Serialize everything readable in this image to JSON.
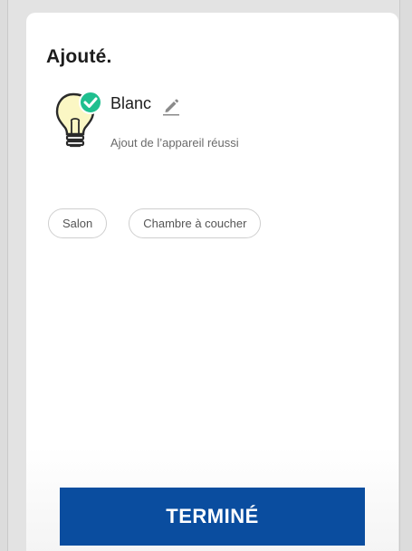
{
  "header": {
    "title": "Ajouté."
  },
  "device": {
    "name": "Blanc",
    "status": "Ajout de l’appareil réussi",
    "icon": "lightbulb-icon",
    "badge_icon": "check-circle-icon",
    "edit_icon": "pencil-icon"
  },
  "rooms": [
    {
      "label": "Salon"
    },
    {
      "label": "Chambre à coucher"
    }
  ],
  "footer": {
    "done_label": "TERMINÉ"
  },
  "colors": {
    "primary": "#0a4d9f",
    "success": "#1fbf8f",
    "bulb_fill": "#fbf7c4"
  }
}
